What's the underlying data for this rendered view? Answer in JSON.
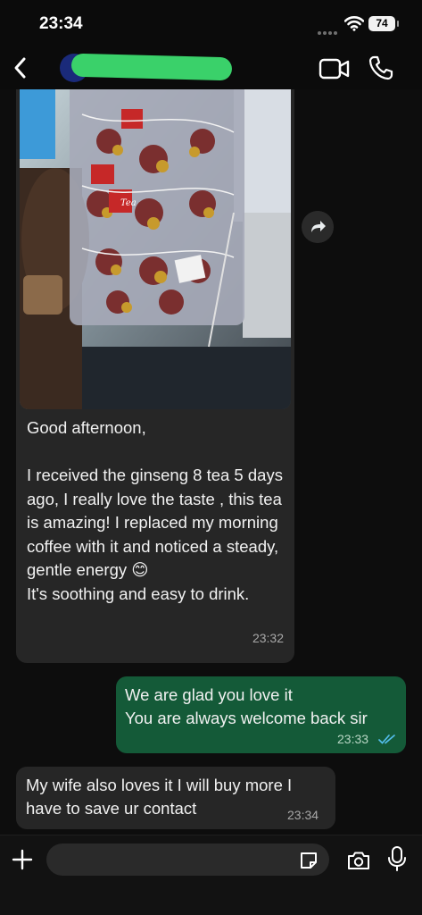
{
  "status_bar": {
    "time": "23:34",
    "battery": "74"
  },
  "chat": {
    "messages": [
      {
        "direction": "incoming",
        "has_photo": true,
        "text": "Good afternoon,\n\nI received the ginseng 8 tea 5 days ago, I really love the taste , this tea is amazing! I replaced my morning coffee with it and noticed a steady, gentle energy 😊\nIt's soothing and easy to drink.",
        "time": "23:32"
      },
      {
        "direction": "outgoing",
        "text": "We are glad you love it\nYou are always welcome back sir",
        "time": "23:33",
        "status": "read"
      },
      {
        "direction": "incoming",
        "text": "My wife also loves it I will buy more I\nhave to save ur contact",
        "time": "23:34"
      }
    ]
  },
  "photo": {
    "pack_label": "Tea"
  },
  "input": {
    "placeholder": ""
  },
  "icons": {
    "back": "chevron-left-icon",
    "video": "video-camera-icon",
    "call": "phone-icon",
    "forward": "forward-arrow-icon",
    "attach": "plus-icon",
    "sticker": "sticker-icon",
    "camera": "camera-icon",
    "mic": "microphone-icon"
  },
  "colors": {
    "background": "#0b0b0b",
    "incoming_bubble": "#262626",
    "outgoing_bubble": "#145a38",
    "read_ticks": "#53bdeb"
  }
}
